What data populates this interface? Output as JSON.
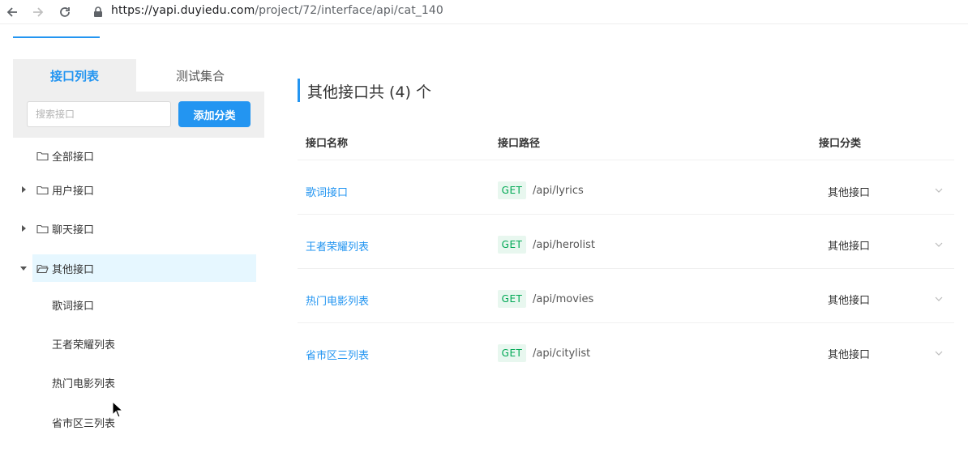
{
  "browser": {
    "url_host": "https://yapi.duyiedu.com",
    "url_path": "/project/72/interface/api/cat_140"
  },
  "sidebar": {
    "tabs": [
      {
        "label": "接口列表",
        "active": true
      },
      {
        "label": "测试集合",
        "active": false
      }
    ],
    "search": {
      "placeholder": "搜索接口",
      "value": ""
    },
    "add_button": "添加分类",
    "tree": [
      {
        "label": "全部接口",
        "expandable": false
      },
      {
        "label": "用户接口",
        "expandable": true,
        "expanded": false
      },
      {
        "label": "聊天接口",
        "expandable": true,
        "expanded": false
      },
      {
        "label": "其他接口",
        "expandable": true,
        "expanded": true,
        "selected": true,
        "children": [
          "歌词接口",
          "王者荣耀列表",
          "热门电影列表",
          "省市区三列表"
        ]
      }
    ]
  },
  "main": {
    "title": "其他接口共 (4) 个",
    "columns": [
      "接口名称",
      "接口路径",
      "接口分类"
    ],
    "rows": [
      {
        "name": "歌词接口",
        "method": "GET",
        "path": "/api/lyrics",
        "category": "其他接口"
      },
      {
        "name": "王者荣耀列表",
        "method": "GET",
        "path": "/api/herolist",
        "category": "其他接口"
      },
      {
        "name": "热门电影列表",
        "method": "GET",
        "path": "/api/movies",
        "category": "其他接口"
      },
      {
        "name": "省市区三列表",
        "method": "GET",
        "path": "/api/citylist",
        "category": "其他接口"
      }
    ]
  },
  "colors": {
    "accent": "#2395f1",
    "get_badge_bg": "#e8f7ef",
    "get_badge_fg": "#00a854",
    "selected_bg": "#e6f7ff"
  },
  "icons": [
    "back-arrow-icon",
    "forward-arrow-icon",
    "reload-icon",
    "lock-icon",
    "folder-icon",
    "caret-right-icon",
    "caret-down-icon",
    "chevron-down-icon"
  ]
}
